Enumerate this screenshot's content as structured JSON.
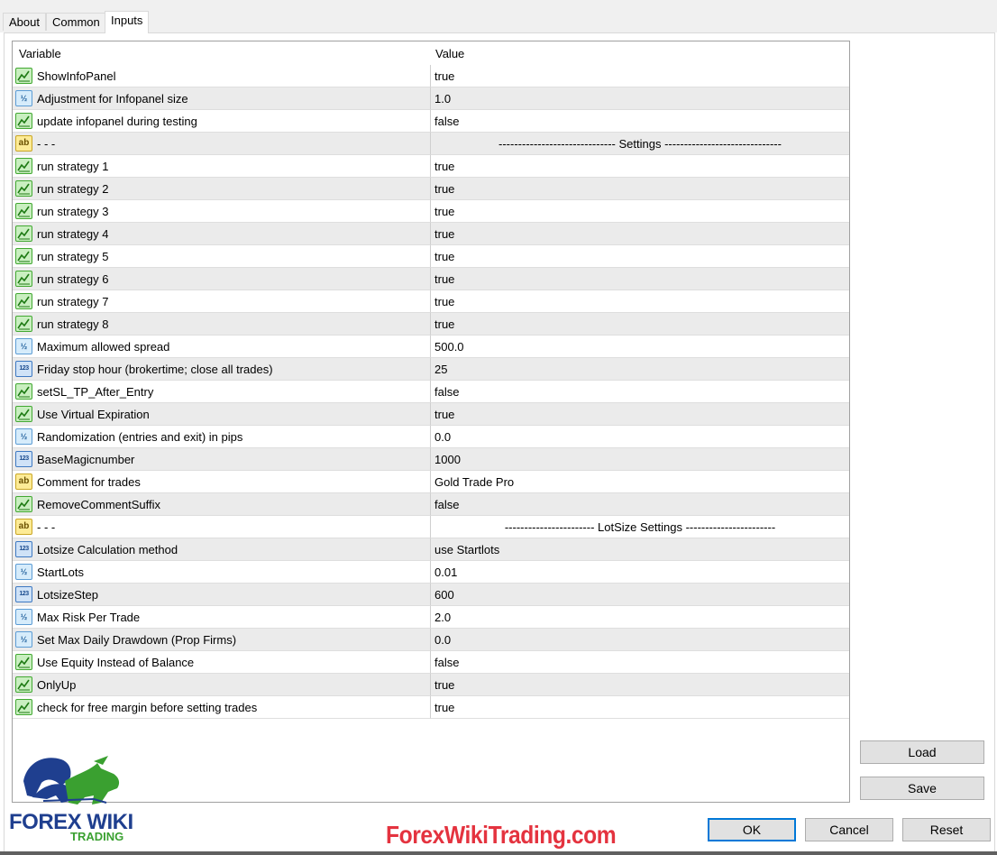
{
  "tabs": [
    {
      "label": "About",
      "active": false
    },
    {
      "label": "Common",
      "active": false
    },
    {
      "label": "Inputs",
      "active": true
    }
  ],
  "table": {
    "columns": [
      "Variable",
      "Value"
    ],
    "rows": [
      {
        "type": "bool",
        "variable": "ShowInfoPanel",
        "value": "true"
      },
      {
        "type": "double",
        "variable": "Adjustment for Infopanel size",
        "value": "1.0"
      },
      {
        "type": "bool",
        "variable": "update infopanel during testing",
        "value": "false"
      },
      {
        "type": "string",
        "variable": "- - -",
        "value": "------------------------------ Settings ------------------------------",
        "center": true
      },
      {
        "type": "bool",
        "variable": "run strategy 1",
        "value": "true"
      },
      {
        "type": "bool",
        "variable": "run strategy 2",
        "value": "true"
      },
      {
        "type": "bool",
        "variable": "run strategy 3",
        "value": "true"
      },
      {
        "type": "bool",
        "variable": "run strategy 4",
        "value": "true"
      },
      {
        "type": "bool",
        "variable": "run strategy 5",
        "value": "true"
      },
      {
        "type": "bool",
        "variable": "run strategy 6",
        "value": "true"
      },
      {
        "type": "bool",
        "variable": "run strategy 7",
        "value": "true"
      },
      {
        "type": "bool",
        "variable": "run strategy 8",
        "value": "true"
      },
      {
        "type": "double",
        "variable": "Maximum allowed spread",
        "value": "500.0"
      },
      {
        "type": "int",
        "variable": "Friday stop hour (brokertime; close all trades)",
        "value": "25"
      },
      {
        "type": "bool",
        "variable": "setSL_TP_After_Entry",
        "value": "false"
      },
      {
        "type": "bool",
        "variable": "Use Virtual Expiration",
        "value": "true"
      },
      {
        "type": "double",
        "variable": "Randomization (entries and exit) in pips",
        "value": "0.0"
      },
      {
        "type": "int",
        "variable": "BaseMagicnumber",
        "value": "1000"
      },
      {
        "type": "string",
        "variable": "Comment for trades",
        "value": "Gold Trade Pro"
      },
      {
        "type": "bool",
        "variable": "RemoveCommentSuffix",
        "value": "false"
      },
      {
        "type": "string",
        "variable": "- - -",
        "value": "----------------------- LotSize Settings -----------------------",
        "center": true
      },
      {
        "type": "int",
        "variable": "Lotsize Calculation method",
        "value": "use Startlots"
      },
      {
        "type": "double",
        "variable": "StartLots",
        "value": "0.01"
      },
      {
        "type": "int",
        "variable": "LotsizeStep",
        "value": "600"
      },
      {
        "type": "double",
        "variable": "Max Risk Per Trade",
        "value": "2.0"
      },
      {
        "type": "double",
        "variable": "Set Max Daily Drawdown (Prop Firms)",
        "value": "0.0"
      },
      {
        "type": "bool",
        "variable": "Use Equity Instead of Balance",
        "value": "false"
      },
      {
        "type": "bool",
        "variable": "OnlyUp",
        "value": "true"
      },
      {
        "type": "bool",
        "variable": "check for free margin before setting trades",
        "value": "true"
      }
    ]
  },
  "icon_glyphs": {
    "double": "½",
    "int": "123",
    "string": "ab"
  },
  "buttons": {
    "load": "Load",
    "save": "Save",
    "ok": "OK",
    "cancel": "Cancel",
    "reset": "Reset"
  },
  "logo": {
    "name": "FOREX WIKI",
    "sub": "TRADING"
  },
  "watermark": "ForexWikiTrading.com",
  "colors": {
    "accent": "#0078d7",
    "watermark": "#e4333f",
    "logo_blue": "#1f3f8f",
    "logo_green": "#3aa030"
  }
}
